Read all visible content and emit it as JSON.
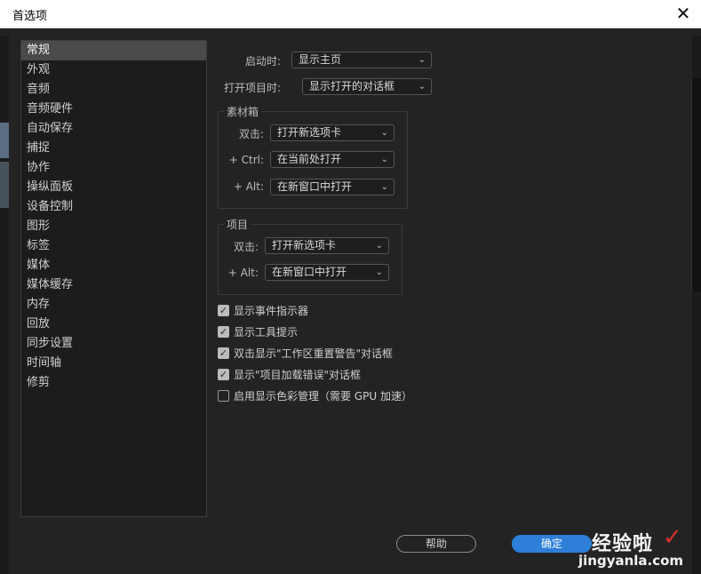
{
  "window": {
    "title": "首选项",
    "close_glyph": "✕"
  },
  "sidebar": {
    "items": [
      {
        "label": "常规",
        "selected": true
      },
      {
        "label": "外观"
      },
      {
        "label": "音频"
      },
      {
        "label": "音频硬件"
      },
      {
        "label": "自动保存"
      },
      {
        "label": "捕捉"
      },
      {
        "label": "协作"
      },
      {
        "label": "操纵面板"
      },
      {
        "label": "设备控制"
      },
      {
        "label": "图形"
      },
      {
        "label": "标签"
      },
      {
        "label": "媒体"
      },
      {
        "label": "媒体缓存"
      },
      {
        "label": "内存"
      },
      {
        "label": "回放"
      },
      {
        "label": "同步设置"
      },
      {
        "label": "时间轴"
      },
      {
        "label": "修剪"
      }
    ]
  },
  "general": {
    "startup_label": "启动时:",
    "startup_value": "显示主页",
    "open_project_label": "打开项目时:",
    "open_project_value": "显示打开的对话框"
  },
  "bin_group": {
    "title": "素材箱",
    "double_click_label": "双击:",
    "double_click_value": "打开新选项卡",
    "ctrl_label": "+ Ctrl:",
    "ctrl_value": "在当前处打开",
    "alt_label": "+ Alt:",
    "alt_value": "在新窗口中打开"
  },
  "project_group": {
    "title": "项目",
    "double_click_label": "双击:",
    "double_click_value": "打开新选项卡",
    "alt_label": "+ Alt:",
    "alt_value": "在新窗口中打开"
  },
  "checkboxes": [
    {
      "label": "显示事件指示器",
      "checked": true
    },
    {
      "label": "显示工具提示",
      "checked": true
    },
    {
      "label": "双击显示\"工作区重置警告\"对话框",
      "checked": true
    },
    {
      "label": "显示\"项目加载错误\"对话框",
      "checked": true
    },
    {
      "label": "启用显示色彩管理（需要 GPU 加速）",
      "checked": false
    }
  ],
  "check_glyph": "✓",
  "chevron_glyph": "⌄",
  "buttons": {
    "help_label": "帮助",
    "ok_label": "确定"
  },
  "watermark": {
    "title": "经验啦",
    "url": "jingyanla.com",
    "check": "✓"
  },
  "colors": {
    "accent": "#2d7fd8",
    "background": "#232323",
    "sidebar_selected": "#4a4a4a"
  }
}
